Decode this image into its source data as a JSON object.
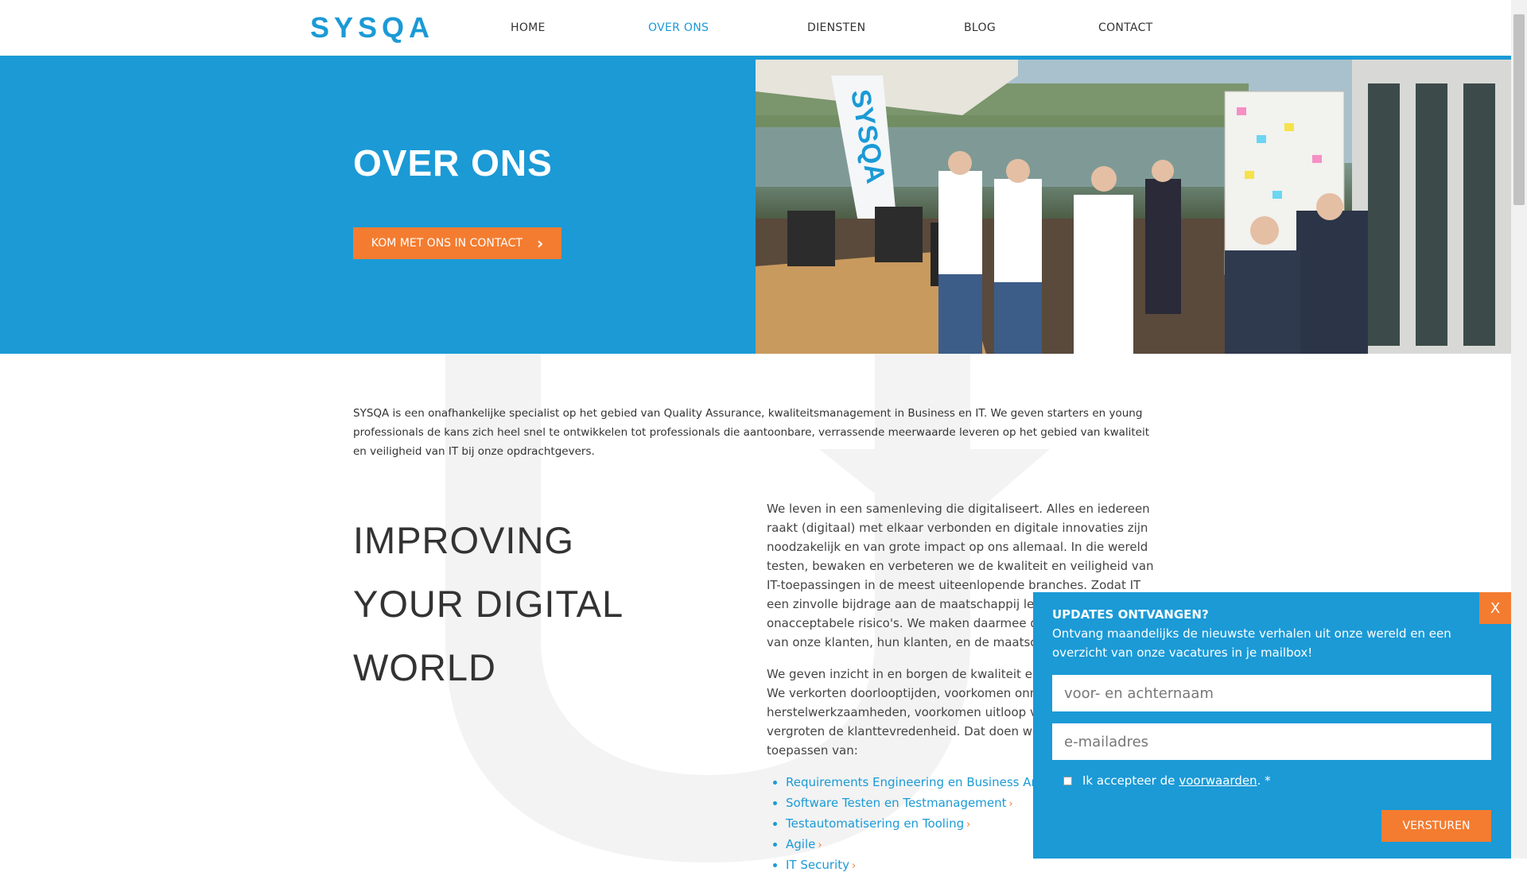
{
  "header": {
    "logo": "SYSQA",
    "nav": [
      {
        "label": "HOME",
        "active": false
      },
      {
        "label": "OVER ONS",
        "active": true
      },
      {
        "label": "DIENSTEN",
        "active": false
      },
      {
        "label": "BLOG",
        "active": false
      },
      {
        "label": "CONTACT",
        "active": false
      }
    ]
  },
  "hero": {
    "title": "OVER ONS",
    "button_label": "KOM MET ONS IN CONTACT",
    "photo_banner_text": "SYSQA"
  },
  "main": {
    "intro": "SYSQA is een onafhankelijke specialist op het gebied van Quality Assurance, kwaliteitsmanagement in Business en IT. We geven starters en young professionals de kans zich heel snel te ontwikkelen tot professionals die aantoonbare, verrassende meerwaarde leveren op het gebied van kwaliteit en veiligheid van IT bij onze opdrachtgevers.",
    "heading_lines": [
      "IMPROVING",
      "YOUR DIGITAL",
      "WORLD"
    ],
    "paragraph_1": "We leven in een samenleving die digitaliseert. Alles en iedereen raakt (digitaal) met elkaar verbonden en digitale innovaties zijn noodzakelijk en van grote impact op ons allemaal. In die wereld testen, bewaken en verbeteren we de kwaliteit en veiligheid van IT-toepassingen in de meest uiteenlopende branches. Zodat IT een zinvolle bijdrage aan de maatschappij levert, zonder onacceptabele risico's. We maken daarmee de digitale wereld van onze klanten, hun klanten, en de maatschappij verbeteren.",
    "paragraph_2": "We geven inzicht in en borgen de kwaliteit en veiligheid van IT. We verkorten doorlooptijden, voorkomen onnodige herstelwerkzaamheden, voorkomen uitloop van je projecten en vergroten de klanttevredenheid. Dat doen we door het toepassen van:",
    "services": [
      "Requirements Engineering en Business Analyse",
      "Software Testen en Testmanagement",
      "Testautomatisering en Tooling",
      "Agile",
      "IT Security"
    ],
    "service_arrow": "›"
  },
  "popup": {
    "close_label": "X",
    "title": "UPDATES ONTVANGEN?",
    "text": "Ontvang maandelijks de nieuwste verhalen uit onze wereld en een overzicht van onze vacatures in je mailbox!",
    "name_placeholder": "voor- en achternaam",
    "email_placeholder": "e-mailadres",
    "consent_prefix": "Ik accepteer de",
    "consent_link": "voorwaarden",
    "consent_suffix": ". *",
    "submit_label": "VERSTUREN"
  },
  "colors": {
    "brand_blue": "#1b9ad6",
    "accent_orange": "#f47c30"
  }
}
